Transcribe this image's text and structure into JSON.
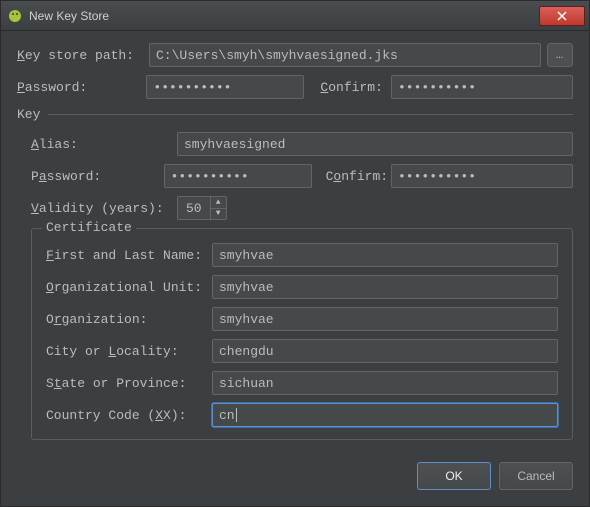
{
  "window": {
    "title": "New Key Store"
  },
  "ks": {
    "path_label": "Key store path:",
    "path_value": "C:\\Users\\smyh\\smyhvaesigned.jks",
    "pw_label": "Password:",
    "pw_value": "••••••••••",
    "confirm_label": "Confirm:",
    "confirm_value": "••••••••••"
  },
  "key_group": {
    "title": "Key",
    "alias_label": "Alias:",
    "alias_value": "smyhvaesigned",
    "pw_label": "Password:",
    "pw_value": "••••••••••",
    "confirm_label": "Confirm:",
    "confirm_value": "••••••••••",
    "validity_label": "Validity (years):",
    "validity_value": "50"
  },
  "cert": {
    "title": "Certificate",
    "first_last_label": "First and Last Name:",
    "first_last_value": "smyhvae",
    "ou_label": "Organizational Unit:",
    "ou_value": "smyhvae",
    "org_label": "Organization:",
    "org_value": "smyhvae",
    "city_label": "City or Locality:",
    "city_value": "chengdu",
    "state_label": "State or Province:",
    "state_value": "sichuan",
    "country_label": "Country Code (XX):",
    "country_value": "cn"
  },
  "buttons": {
    "ok": "OK",
    "cancel": "Cancel"
  }
}
